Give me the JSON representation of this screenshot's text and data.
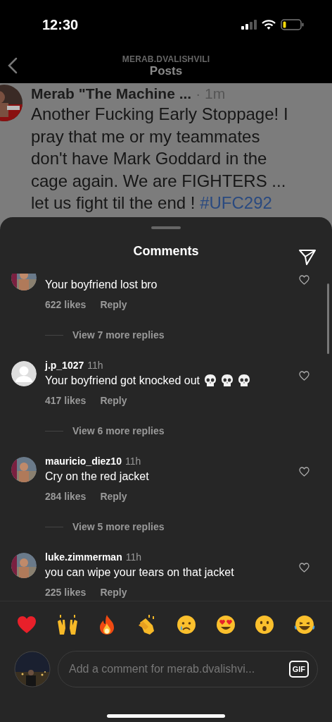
{
  "status_bar": {
    "time": "12:30"
  },
  "header": {
    "account": "MERAB.DVALISHVILI",
    "title": "Posts"
  },
  "post": {
    "author": "Merab \"The Machine ...",
    "time": "· 1m",
    "text": "Another Fucking Early Stoppage! I pray that me or my teammates don't have Mark Goddard in the cage again. We are FIGHTERS ... let us fight til the end ! ",
    "hashtag": "#UFC292"
  },
  "sheet": {
    "title": "Comments"
  },
  "comments": [
    {
      "text": "Your boyfriend lost bro",
      "likes": "622 likes",
      "reply": "Reply",
      "more_replies": "View 7 more replies"
    },
    {
      "avatar": {
        "kind": "default"
      },
      "username": "j.p_1027",
      "time": "11h",
      "text": "Your boyfriend got knocked out",
      "icons": [
        {
          "kind": "skull"
        },
        {
          "kind": "skull"
        },
        {
          "kind": "skull"
        }
      ],
      "likes": "417 likes",
      "reply": "Reply",
      "more_replies": "View 6 more replies"
    },
    {
      "username": "mauricio_diez10",
      "time": "11h",
      "text": "Cry on the red jacket",
      "likes": "284 likes",
      "reply": "Reply",
      "more_replies": "View 5 more replies"
    },
    {
      "username": "luke.zimmerman",
      "time": "11h",
      "text": "you can wipe your tears on that jacket",
      "likes": "225 likes",
      "reply": "Reply"
    }
  ],
  "reactions": [
    {
      "kind": "heart"
    },
    {
      "kind": "raised-hands"
    },
    {
      "kind": "fire"
    },
    {
      "kind": "clap"
    },
    {
      "kind": "crying"
    },
    {
      "kind": "heart-eyes"
    },
    {
      "kind": "surprised"
    },
    {
      "kind": "laughing"
    }
  ],
  "composer": {
    "placeholder": "Add a comment for merab.dvalishvi...",
    "gif": "GIF"
  }
}
